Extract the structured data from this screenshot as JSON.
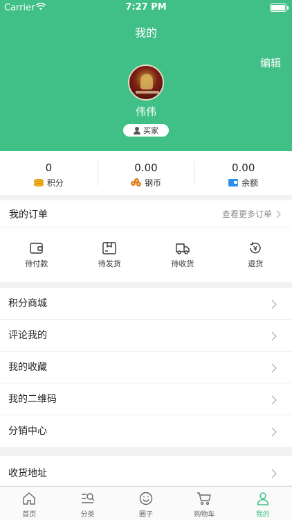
{
  "status_bar": {
    "carrier": "Carrier",
    "time": "7:27 PM"
  },
  "header": {
    "title": "我的",
    "edit_label": "编辑",
    "username": "伟伟",
    "role_badge": "买家"
  },
  "stats": [
    {
      "value": "0",
      "label": "积分",
      "icon": "coin-stack-icon"
    },
    {
      "value": "0.00",
      "label": "钢币",
      "icon": "copper-coins-icon"
    },
    {
      "value": "0.00",
      "label": "余额",
      "icon": "wallet-icon"
    }
  ],
  "orders": {
    "title": "我的订单",
    "more_label": "查看更多订单",
    "items": [
      {
        "label": "待付款",
        "icon": "wallet-outline-icon"
      },
      {
        "label": "待发货",
        "icon": "package-icon"
      },
      {
        "label": "待收货",
        "icon": "truck-icon"
      },
      {
        "label": "退货",
        "icon": "refund-icon"
      }
    ]
  },
  "menu": [
    {
      "label": "积分商城"
    },
    {
      "label": "评论我的"
    },
    {
      "label": "我的收藏"
    },
    {
      "label": "我的二维码"
    },
    {
      "label": "分销中心"
    }
  ],
  "menu2": [
    {
      "label": "收货地址"
    }
  ],
  "tabbar": [
    {
      "label": "首页",
      "icon": "home-icon"
    },
    {
      "label": "分类",
      "icon": "category-search-icon"
    },
    {
      "label": "圈子",
      "icon": "smiley-icon"
    },
    {
      "label": "购物车",
      "icon": "cart-icon"
    },
    {
      "label": "我的",
      "icon": "user-icon"
    }
  ],
  "colors": {
    "brand": "#40bf86",
    "accent_active": "#40bf86"
  }
}
